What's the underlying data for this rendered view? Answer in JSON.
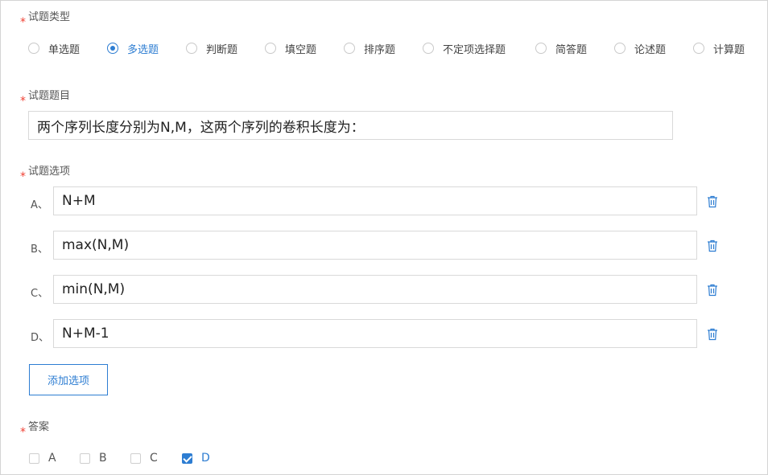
{
  "type_section": {
    "label": "试题类型",
    "options": [
      {
        "label": "单选题",
        "checked": false
      },
      {
        "label": "多选题",
        "checked": true
      },
      {
        "label": "判断题",
        "checked": false
      },
      {
        "label": "填空题",
        "checked": false
      },
      {
        "label": "排序题",
        "checked": false
      },
      {
        "label": "不定项选择题",
        "checked": false
      },
      {
        "label": "简答题",
        "checked": false
      },
      {
        "label": "论述题",
        "checked": false
      },
      {
        "label": "计算题",
        "checked": false
      }
    ]
  },
  "question_section": {
    "label": "试题题目",
    "value": "两个序列长度分别为N,M，这两个序列的卷积长度为："
  },
  "options_section": {
    "label": "试题选项",
    "items": [
      {
        "letter": "A、",
        "value": "N+M"
      },
      {
        "letter": "B、",
        "value": "max(N,M)"
      },
      {
        "letter": "C、",
        "value": "min(N,M)"
      },
      {
        "letter": "D、",
        "value": "N+M-1"
      }
    ],
    "add_button": "添加选项"
  },
  "answer_section": {
    "label": "答案",
    "choices": [
      {
        "label": "A",
        "checked": false
      },
      {
        "label": "B",
        "checked": false
      },
      {
        "label": "C",
        "checked": false
      },
      {
        "label": "D",
        "checked": true
      }
    ]
  },
  "required_mark": "*",
  "colors": {
    "accent": "#2d7dd2",
    "required": "#f04134",
    "border": "#d9d9d9"
  }
}
